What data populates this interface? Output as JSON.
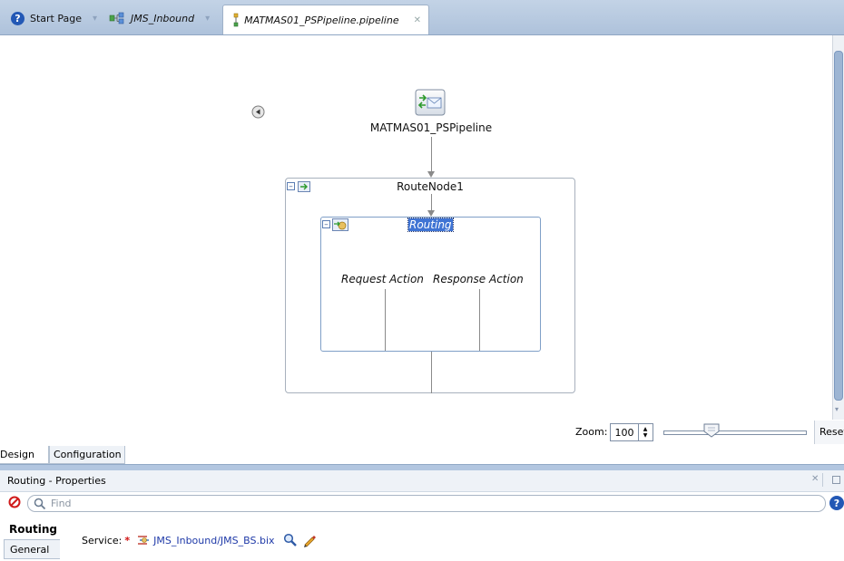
{
  "tabs": [
    {
      "label": "Start Page",
      "icon": "help-icon",
      "active": false
    },
    {
      "label": "JMS_Inbound",
      "icon": "composite-icon",
      "active": false
    },
    {
      "label": "MATMAS01_PSPipeline.pipeline",
      "icon": "pipeline-icon",
      "active": true
    }
  ],
  "canvas": {
    "pipeline_label": "MATMAS01_PSPipeline",
    "route_node_label": "RouteNode1",
    "routing_label": "Routing",
    "request_action_label": "Request Action",
    "response_action_label": "Response Action",
    "highlight_color": "#3f74d4"
  },
  "zoom": {
    "label": "Zoom:",
    "value": "100",
    "reset_label": "Reset"
  },
  "editor_tabs": {
    "design": "Design",
    "configuration": "Configuration"
  },
  "properties": {
    "title": "Routing - Properties",
    "find_placeholder": "Find",
    "section_title": "Routing",
    "general_tab": "General",
    "service_label": "Service:",
    "required_mark": "*",
    "service_value": "JMS_Inbound/JMS_BS.bix",
    "required_color": "#d01010",
    "link_color": "#1f3aa8"
  }
}
